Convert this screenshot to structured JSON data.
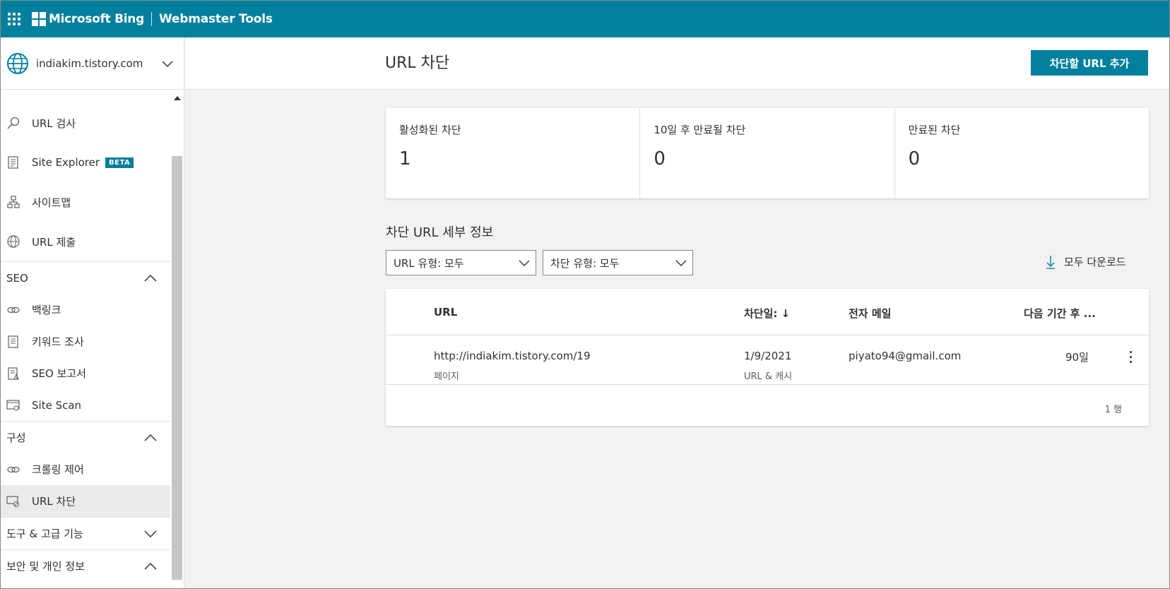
{
  "topbar": {
    "brand": "Microsoft Bing",
    "product": "Webmaster Tools"
  },
  "site_picker": {
    "site": "indiakim.tistory.com"
  },
  "sidebar": {
    "items_top": [
      {
        "label": "URL 검사"
      },
      {
        "label": "Site Explorer",
        "badge": "BETA"
      },
      {
        "label": "사이트맵"
      },
      {
        "label": "URL 제출"
      }
    ],
    "seo": {
      "label": "SEO",
      "items": [
        {
          "label": "백링크"
        },
        {
          "label": "키워드 조사"
        },
        {
          "label": "SEO 보고서"
        },
        {
          "label": "Site Scan"
        }
      ]
    },
    "config": {
      "label": "구성",
      "items": [
        {
          "label": "크롤링 제어"
        },
        {
          "label": "URL 차단"
        }
      ]
    },
    "tools": {
      "label": "도구 & 고급 기능"
    },
    "security": {
      "label": "보안 및 개인 정보"
    }
  },
  "header": {
    "title": "URL 차단",
    "add_button": "차단할 URL 추가"
  },
  "stats": [
    {
      "label": "활성화된 차단",
      "value": "1"
    },
    {
      "label": "10일 후 만료될 차단",
      "value": "0"
    },
    {
      "label": "만료된 차단",
      "value": "0"
    }
  ],
  "details": {
    "title": "차단 URL 세부 정보",
    "filter_url_type": "URL 유형: 모두",
    "filter_block_type": "차단 유형: 모두",
    "download": "모두 다운로드"
  },
  "table": {
    "columns": [
      "URL",
      "차단일: ↓",
      "전자 메일",
      "다음 기간 후 ..."
    ],
    "rows": [
      {
        "url": "http://indiakim.tistory.com/19",
        "url_type": "페이지",
        "date": "1/9/2021",
        "block_type": "URL & 캐시",
        "email": "piyato94@gmail.com",
        "expires": "90일"
      }
    ],
    "row_count": "1 행"
  },
  "colors": {
    "accent": "#00809d",
    "active_nav": "#edebe9",
    "background": "#f3f2f1"
  }
}
